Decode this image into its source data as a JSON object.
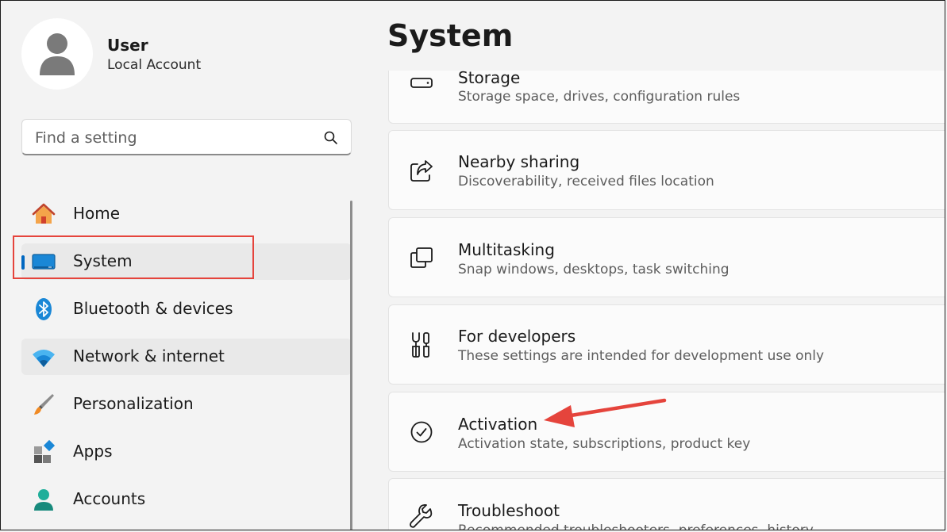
{
  "user": {
    "name": "User",
    "account_type": "Local Account"
  },
  "search": {
    "placeholder": "Find a setting",
    "value": ""
  },
  "sidebar": {
    "items": [
      {
        "label": "Home",
        "icon": "home-icon"
      },
      {
        "label": "System",
        "icon": "system-display-icon",
        "selected": true
      },
      {
        "label": "Bluetooth & devices",
        "icon": "bluetooth-icon"
      },
      {
        "label": "Network & internet",
        "icon": "wifi-icon"
      },
      {
        "label": "Personalization",
        "icon": "paintbrush-icon"
      },
      {
        "label": "Apps",
        "icon": "apps-icon"
      },
      {
        "label": "Accounts",
        "icon": "account-icon"
      }
    ]
  },
  "main": {
    "title": "System",
    "cards": [
      {
        "title": "Storage",
        "subtitle": "Storage space, drives, configuration rules",
        "icon": "storage-drive-icon"
      },
      {
        "title": "Nearby sharing",
        "subtitle": "Discoverability, received files location",
        "icon": "share-icon"
      },
      {
        "title": "Multitasking",
        "subtitle": "Snap windows, desktops, task switching",
        "icon": "multitasking-icon"
      },
      {
        "title": "For developers",
        "subtitle": "These settings are intended for development use only",
        "icon": "developer-tools-icon"
      },
      {
        "title": "Activation",
        "subtitle": "Activation state, subscriptions, product key",
        "icon": "checkmark-circle-icon"
      },
      {
        "title": "Troubleshoot",
        "subtitle": "Recommended troubleshooters, preferences, history",
        "icon": "wrench-icon"
      }
    ]
  },
  "annotations": {
    "highlight_color": "#e5443c",
    "accent_color": "#0067c0"
  }
}
